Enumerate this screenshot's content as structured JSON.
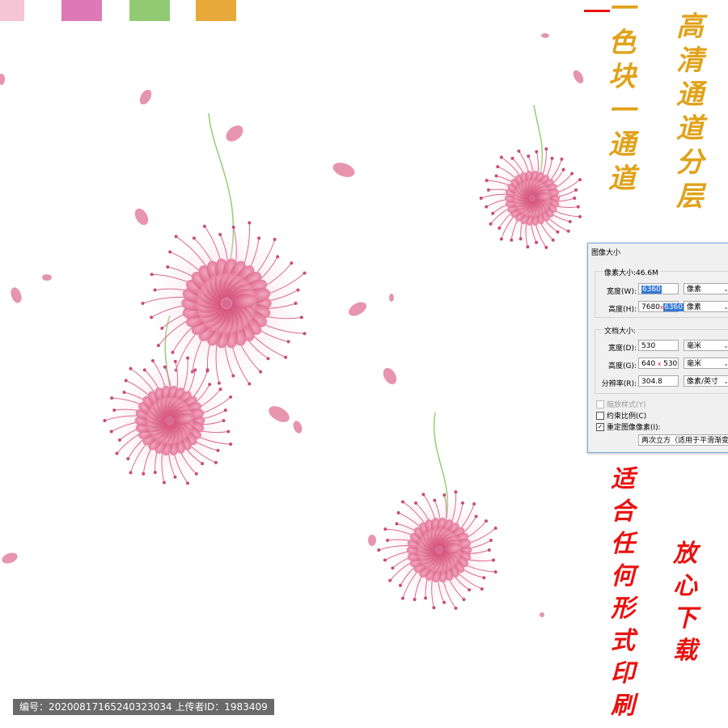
{
  "swatches": [
    "#f5c5d5",
    "#dc79b6",
    "#92ca73",
    "#e6a93a"
  ],
  "gold_text_1": [
    "一",
    "色",
    "块",
    "一",
    "通",
    "道"
  ],
  "gold_text_2": [
    "高",
    "清",
    "通",
    "道",
    "分",
    "层"
  ],
  "red_text_1": [
    "适",
    "合",
    "任",
    "何",
    "形",
    "式",
    "印",
    "刷"
  ],
  "red_text_2": [
    "放",
    "心",
    "下",
    "载"
  ],
  "dialog": {
    "title": "图像大小",
    "pixel_group": "像素大小:46.6M",
    "width_label": "宽度(W):",
    "width_value": "6360",
    "height_label": "高度(H):",
    "height_prefix": "7680",
    "height_mark": "x",
    "height_value": "6360",
    "unit_pixel": "像素",
    "doc_group": "文档大小:",
    "doc_width_label": "宽度(D):",
    "doc_width_value": "530",
    "doc_height_label": "高度(G):",
    "doc_height_prefix": "640",
    "doc_height_mark": "x",
    "doc_height_value": "530",
    "unit_mm": "毫米",
    "resolution_label": "分辨率(R):",
    "resolution_value": "304.8",
    "unit_ppi": "像素/英寸",
    "scale_styles": "缩放样式(Y)",
    "constrain": "约束比例(C)",
    "resample": "重定图像像素(I):",
    "resample_method": "两次立方（适用于平滑渐变"
  },
  "footer": "编号：20200817165240323034 上传者ID：1983409"
}
